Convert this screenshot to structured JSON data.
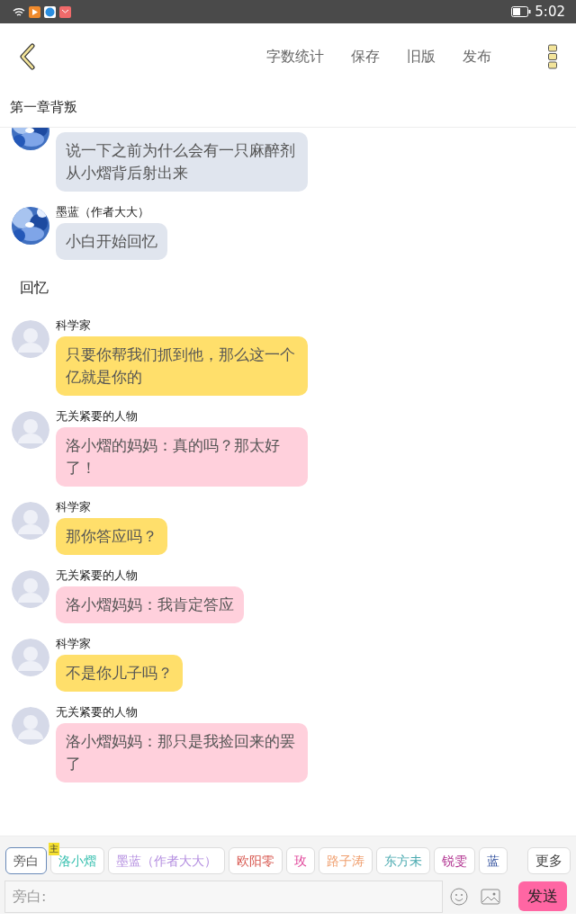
{
  "status_bar": {
    "time": "5:02"
  },
  "toolbar": {
    "actions": [
      "字数统计",
      "保存",
      "旧版",
      "发布"
    ]
  },
  "chapter_title": "第一章背叛",
  "messages": [
    {
      "kind": "author",
      "color": "#e0e5ee",
      "text": "说一下之前为什么会有一只麻醉剂从小熠背后射出来"
    },
    {
      "kind": "author",
      "name": "墨蓝（作者大大）",
      "color": "#e0e5ee",
      "text": "小白开始回忆"
    },
    {
      "kind": "narration",
      "text": "回忆"
    },
    {
      "kind": "character",
      "name": "科学家",
      "color": "#ffdf6b",
      "text": "只要你帮我们抓到他，那么这一个亿就是你的"
    },
    {
      "kind": "character",
      "name": "无关紧要的人物",
      "color": "#ffd0dc",
      "text": "洛小熠的妈妈：真的吗？那太好了！"
    },
    {
      "kind": "character",
      "name": "科学家",
      "color": "#ffdf6b",
      "text": "那你答应吗？"
    },
    {
      "kind": "character",
      "name": "无关紧要的人物",
      "color": "#ffd0dc",
      "text": "洛小熠妈妈：我肯定答应"
    },
    {
      "kind": "character",
      "name": "科学家",
      "color": "#ffdf6b",
      "text": "不是你儿子吗？"
    },
    {
      "kind": "character",
      "name": "无关紧要的人物",
      "color": "#ffd0dc",
      "text": "洛小熠妈妈：那只是我捡回来的罢了"
    }
  ],
  "characters": [
    {
      "label": "旁白",
      "color": "#555555",
      "selected": true
    },
    {
      "label": "洛小熠",
      "color": "#34bfae",
      "selected": false,
      "badge": "主"
    },
    {
      "label": "墨蓝（作者大大）",
      "color": "#b48ee0",
      "selected": false
    },
    {
      "label": "欧阳零",
      "color": "#d6524a",
      "selected": false
    },
    {
      "label": "玫",
      "color": "#e0459a",
      "selected": false
    },
    {
      "label": "路子涛",
      "color": "#f0a070",
      "selected": false
    },
    {
      "label": "东方未",
      "color": "#4aaab0",
      "selected": false
    },
    {
      "label": "锐雯",
      "color": "#b0308f",
      "selected": false
    },
    {
      "label": "蓝",
      "color": "#2a4a9a",
      "selected": false
    }
  ],
  "more_button": "更多",
  "composer": {
    "placeholder": "旁白:",
    "send": "发送"
  }
}
